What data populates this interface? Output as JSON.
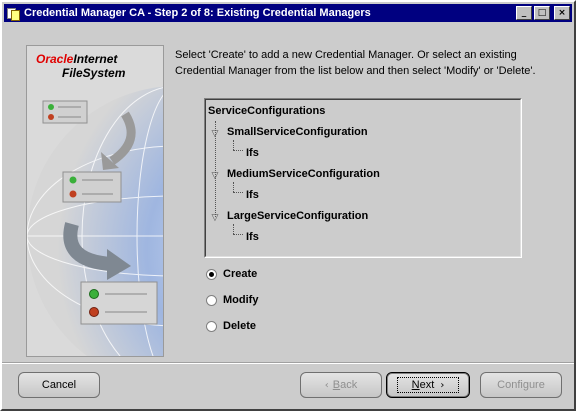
{
  "window": {
    "title": "Credential Manager CA - Step 2 of 8: Existing Credential Managers",
    "controls": {
      "minimize": "_",
      "maximize": "□",
      "close": "×"
    }
  },
  "branding": {
    "oracle": "Oracle",
    "internet": "Internet",
    "filesystem": "FileSystem"
  },
  "instructions": "Select 'Create' to add a new Credential Manager. Or select an existing Credential Manager from the list below and then select 'Modify' or 'Delete'.",
  "tree": {
    "root": "ServiceConfigurations",
    "children": [
      {
        "label": "SmallServiceConfiguration",
        "child": "Ifs"
      },
      {
        "label": "MediumServiceConfiguration",
        "child": "Ifs"
      },
      {
        "label": "LargeServiceConfiguration",
        "child": "Ifs"
      }
    ],
    "expander_glyph": "▽"
  },
  "options": [
    {
      "label": "Create",
      "selected": true
    },
    {
      "label": "Modify",
      "selected": false
    },
    {
      "label": "Delete",
      "selected": false
    }
  ],
  "buttons": {
    "cancel": "Cancel",
    "back_mnemonic": "B",
    "back_rest": "ack",
    "back_chevron": "‹",
    "next_mnemonic": "N",
    "next_rest": "ext",
    "next_chevron": "›",
    "configure": "Configure"
  },
  "colors": {
    "titlebar": "#000080",
    "oracle_red": "#e00000",
    "dialog_bg": "#cccccc"
  }
}
